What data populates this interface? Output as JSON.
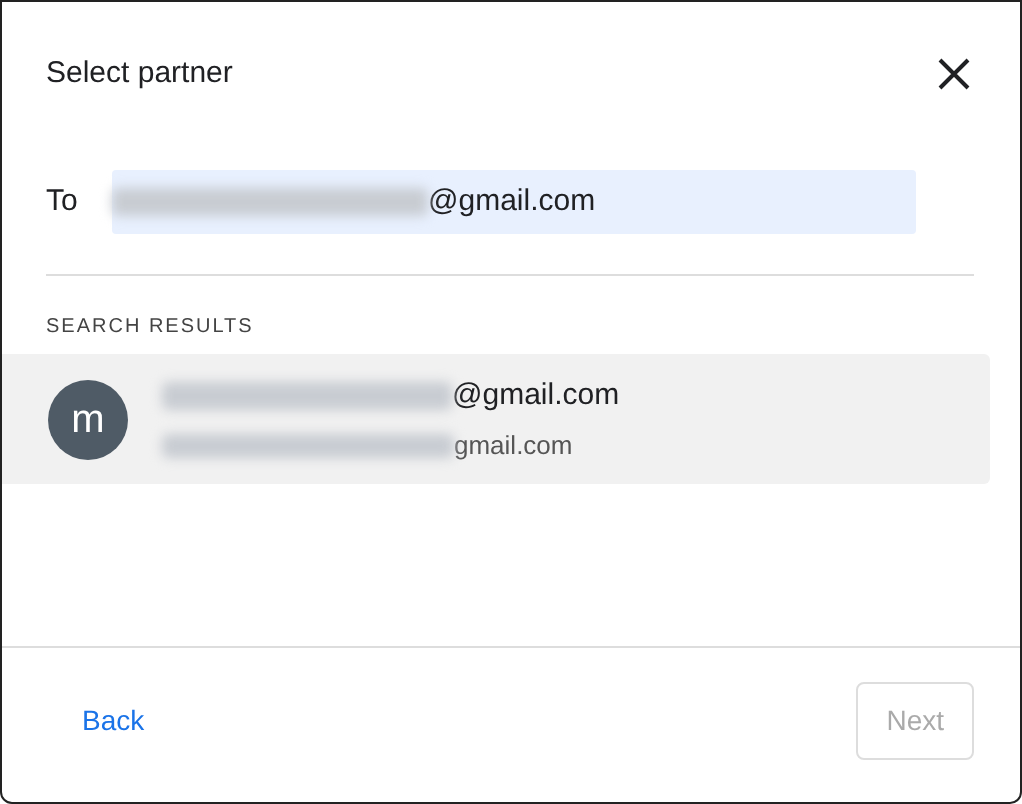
{
  "dialog": {
    "title": "Select partner"
  },
  "to_field": {
    "label": "To",
    "value_visible_part": "@gmail.com",
    "blurred": true
  },
  "results_heading": "SEARCH RESULTS",
  "results": [
    {
      "avatar": "m",
      "primary_visible_part": "@gmail.com",
      "secondary_visible_part": "gmail.com",
      "blurred": true,
      "selected": true
    }
  ],
  "footer": {
    "back": "Back",
    "next": "Next",
    "next_disabled": true
  }
}
